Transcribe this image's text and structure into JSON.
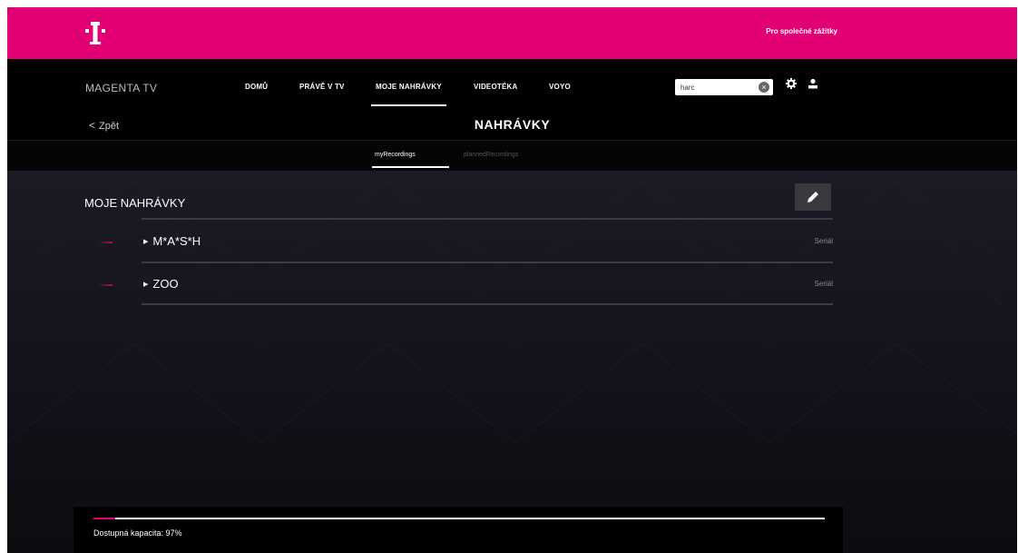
{
  "topbar": {
    "logo_icon": "telekom-t-logo-icon",
    "accent_color": "#e20074",
    "link_label": "Pro společné zážitky"
  },
  "nav": {
    "brand": "MAGENTA TV",
    "items": [
      {
        "label": "DOMŮ",
        "active": false
      },
      {
        "label": "PRÁVĚ V TV",
        "active": false
      },
      {
        "label": "MOJE NAHRÁVKY",
        "active": true
      },
      {
        "label": "VIDEOTÉKA",
        "active": false
      },
      {
        "label": "VOYO",
        "active": false
      }
    ],
    "search_value": "harc",
    "search_clear_icon": "clear-circle-icon",
    "settings_icon": "gear-icon",
    "profile_icon": "user-icon"
  },
  "header": {
    "back_label": "Zpět",
    "title": "NAHRÁVKY"
  },
  "subtabs": [
    {
      "label": "myRecordings",
      "active": true
    },
    {
      "label": "plannedRecordings",
      "active": false
    }
  ],
  "section": {
    "title": "MOJE NAHRÁVKY",
    "edit_icon": "pencil-icon"
  },
  "recordings": [
    {
      "title": "M*A*S*H",
      "type": "Seriál"
    },
    {
      "title": "ZOO",
      "type": "Seriál"
    }
  ],
  "capacity": {
    "label": "Dostupná kapacita: 97%",
    "used_fraction": 0.03
  }
}
